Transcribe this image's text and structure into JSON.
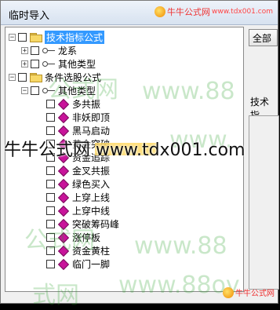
{
  "window": {
    "title": "临时导入"
  },
  "brand": {
    "name": "牛牛公式网",
    "url": "www.tdx001.com",
    "overlay": "牛牛公式网 www.tdx001.com"
  },
  "tree": {
    "root1": {
      "label": "技术指标公式",
      "children": [
        "龙系",
        "其他类型"
      ]
    },
    "root2": {
      "label": "条件选股公式",
      "group": "其他类型",
      "items": [
        "多共振",
        "非妖即顶",
        "黑马启动",
        "黄金突破",
        "资金追踪",
        "金叉共振",
        "绿色买入",
        "上穿上线",
        "上穿中线",
        "突破筹码峰",
        "涨停板",
        "资金黄柱",
        "临门一脚"
      ]
    }
  },
  "right": {
    "all_button": "全部",
    "label": "技术指"
  },
  "watermarks": [
    "公式网",
    "www.88",
    "www.",
    "公式网",
    "www.88",
    "www.88ov",
    "式网"
  ]
}
